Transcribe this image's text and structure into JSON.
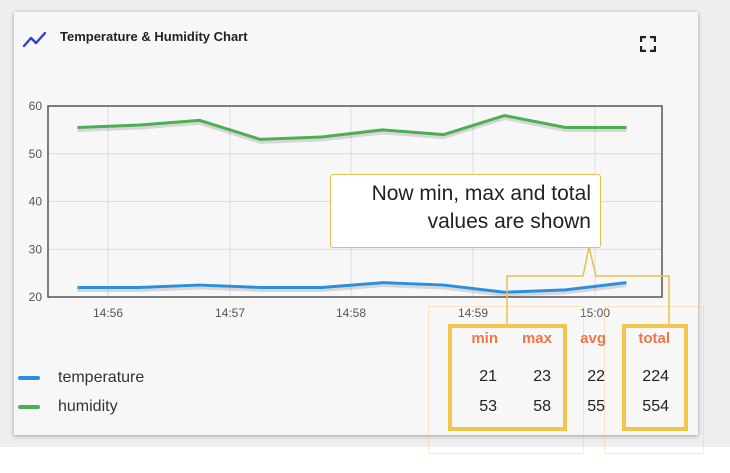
{
  "card": {
    "title": "Temperature & Humidity Chart",
    "header_icon": "line-chart-icon",
    "fullscreen_icon": "fullscreen-icon",
    "accent_color": "#2f3fd6"
  },
  "chart_data": {
    "type": "line",
    "title": "Temperature & Humidity Chart",
    "x_ticks": [
      "14:56",
      "14:57",
      "14:58",
      "14:59",
      "15:00"
    ],
    "y_ticks": [
      20,
      30,
      40,
      50,
      60
    ],
    "ylim": [
      20,
      60
    ],
    "grid": true,
    "legend_position": "bottom-left",
    "x": [
      "14:55:45",
      "14:56:15",
      "14:56:45",
      "14:57:15",
      "14:57:45",
      "14:58:15",
      "14:58:45",
      "14:59:15",
      "14:59:45",
      "15:00:15"
    ],
    "series": [
      {
        "name": "temperature",
        "color": "#2b8fe0",
        "values": [
          22,
          22,
          22.5,
          22,
          22,
          23,
          22.5,
          21,
          21.5,
          23
        ]
      },
      {
        "name": "humidity",
        "color": "#4caf50",
        "values": [
          55.5,
          56,
          57,
          53,
          53.5,
          55,
          54,
          58,
          55.5,
          55.5
        ]
      }
    ]
  },
  "legend": {
    "items": [
      {
        "label": "temperature",
        "color": "#2b8fe0"
      },
      {
        "label": "humidity",
        "color": "#4caf50"
      }
    ]
  },
  "stats": {
    "headers": [
      "min",
      "max",
      "avg",
      "total"
    ],
    "rows": [
      [
        "21",
        "23",
        "22",
        "224"
      ],
      [
        "53",
        "58",
        "55",
        "554"
      ]
    ],
    "header_color": "#f07645",
    "highlight_color": "#f2c64d"
  },
  "callout": {
    "line1": "Now min, max and total",
    "line2": "values are shown"
  }
}
